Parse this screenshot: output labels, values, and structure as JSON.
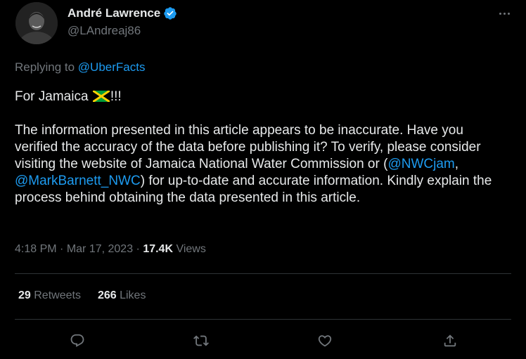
{
  "author": {
    "name": "André Lawrence",
    "handle": "@LAndreaj86",
    "verified": true
  },
  "reply": {
    "prefix": "Replying to ",
    "to": "@UberFacts"
  },
  "body": {
    "line1_text": "For Jamaica ",
    "line1_suffix": "!!!",
    "paragraph_part1": "The information presented in this article appears to be inaccurate. Have you verified the accuracy of the data before publishing it? To verify, please consider visiting the website of Jamaica National Water Commission or (",
    "mention1": "@NWCjam",
    "separator": ", ",
    "mention2": "@MarkBarnett_NWC",
    "paragraph_part2": ") for up-to-date and accurate information. Kindly explain the process behind obtaining the data presented in this article."
  },
  "meta": {
    "time": "4:18 PM",
    "sep1": " · ",
    "date": "Mar 17, 2023",
    "sep2": " · ",
    "views_count": "17.4K",
    "views_label": " Views"
  },
  "stats": {
    "retweets_count": "29",
    "retweets_label": " Retweets",
    "likes_count": "266",
    "likes_label": " Likes"
  },
  "colors": {
    "background": "#000000",
    "text_primary": "#e7e9ea",
    "text_secondary": "#71767b",
    "link": "#1d9bf0",
    "divider": "#2f3336"
  },
  "icons": {
    "more": "more-horizontal-icon",
    "verified": "verified-badge-icon",
    "flag": "jamaica-flag-icon",
    "reply": "reply-icon",
    "retweet": "retweet-icon",
    "like": "heart-icon",
    "share": "share-icon"
  }
}
